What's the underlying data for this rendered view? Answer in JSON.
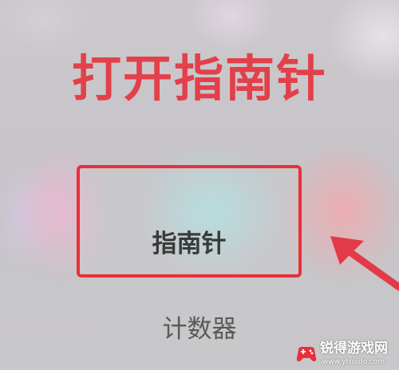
{
  "heading": {
    "text": "打开指南针",
    "color": "#e2404a"
  },
  "apps": [
    {
      "label": "指南针",
      "highlighted": true,
      "highlight_color": "#e8303a"
    },
    {
      "label": "计数器",
      "highlighted": false
    }
  ],
  "annotation": {
    "arrow_icon": "red-arrow-icon",
    "arrow_color": "#e23a48"
  },
  "watermark": {
    "title": "锐得游戏网",
    "url": "www.ytruido.com",
    "logo_icon": "gamepad-logo-icon"
  }
}
